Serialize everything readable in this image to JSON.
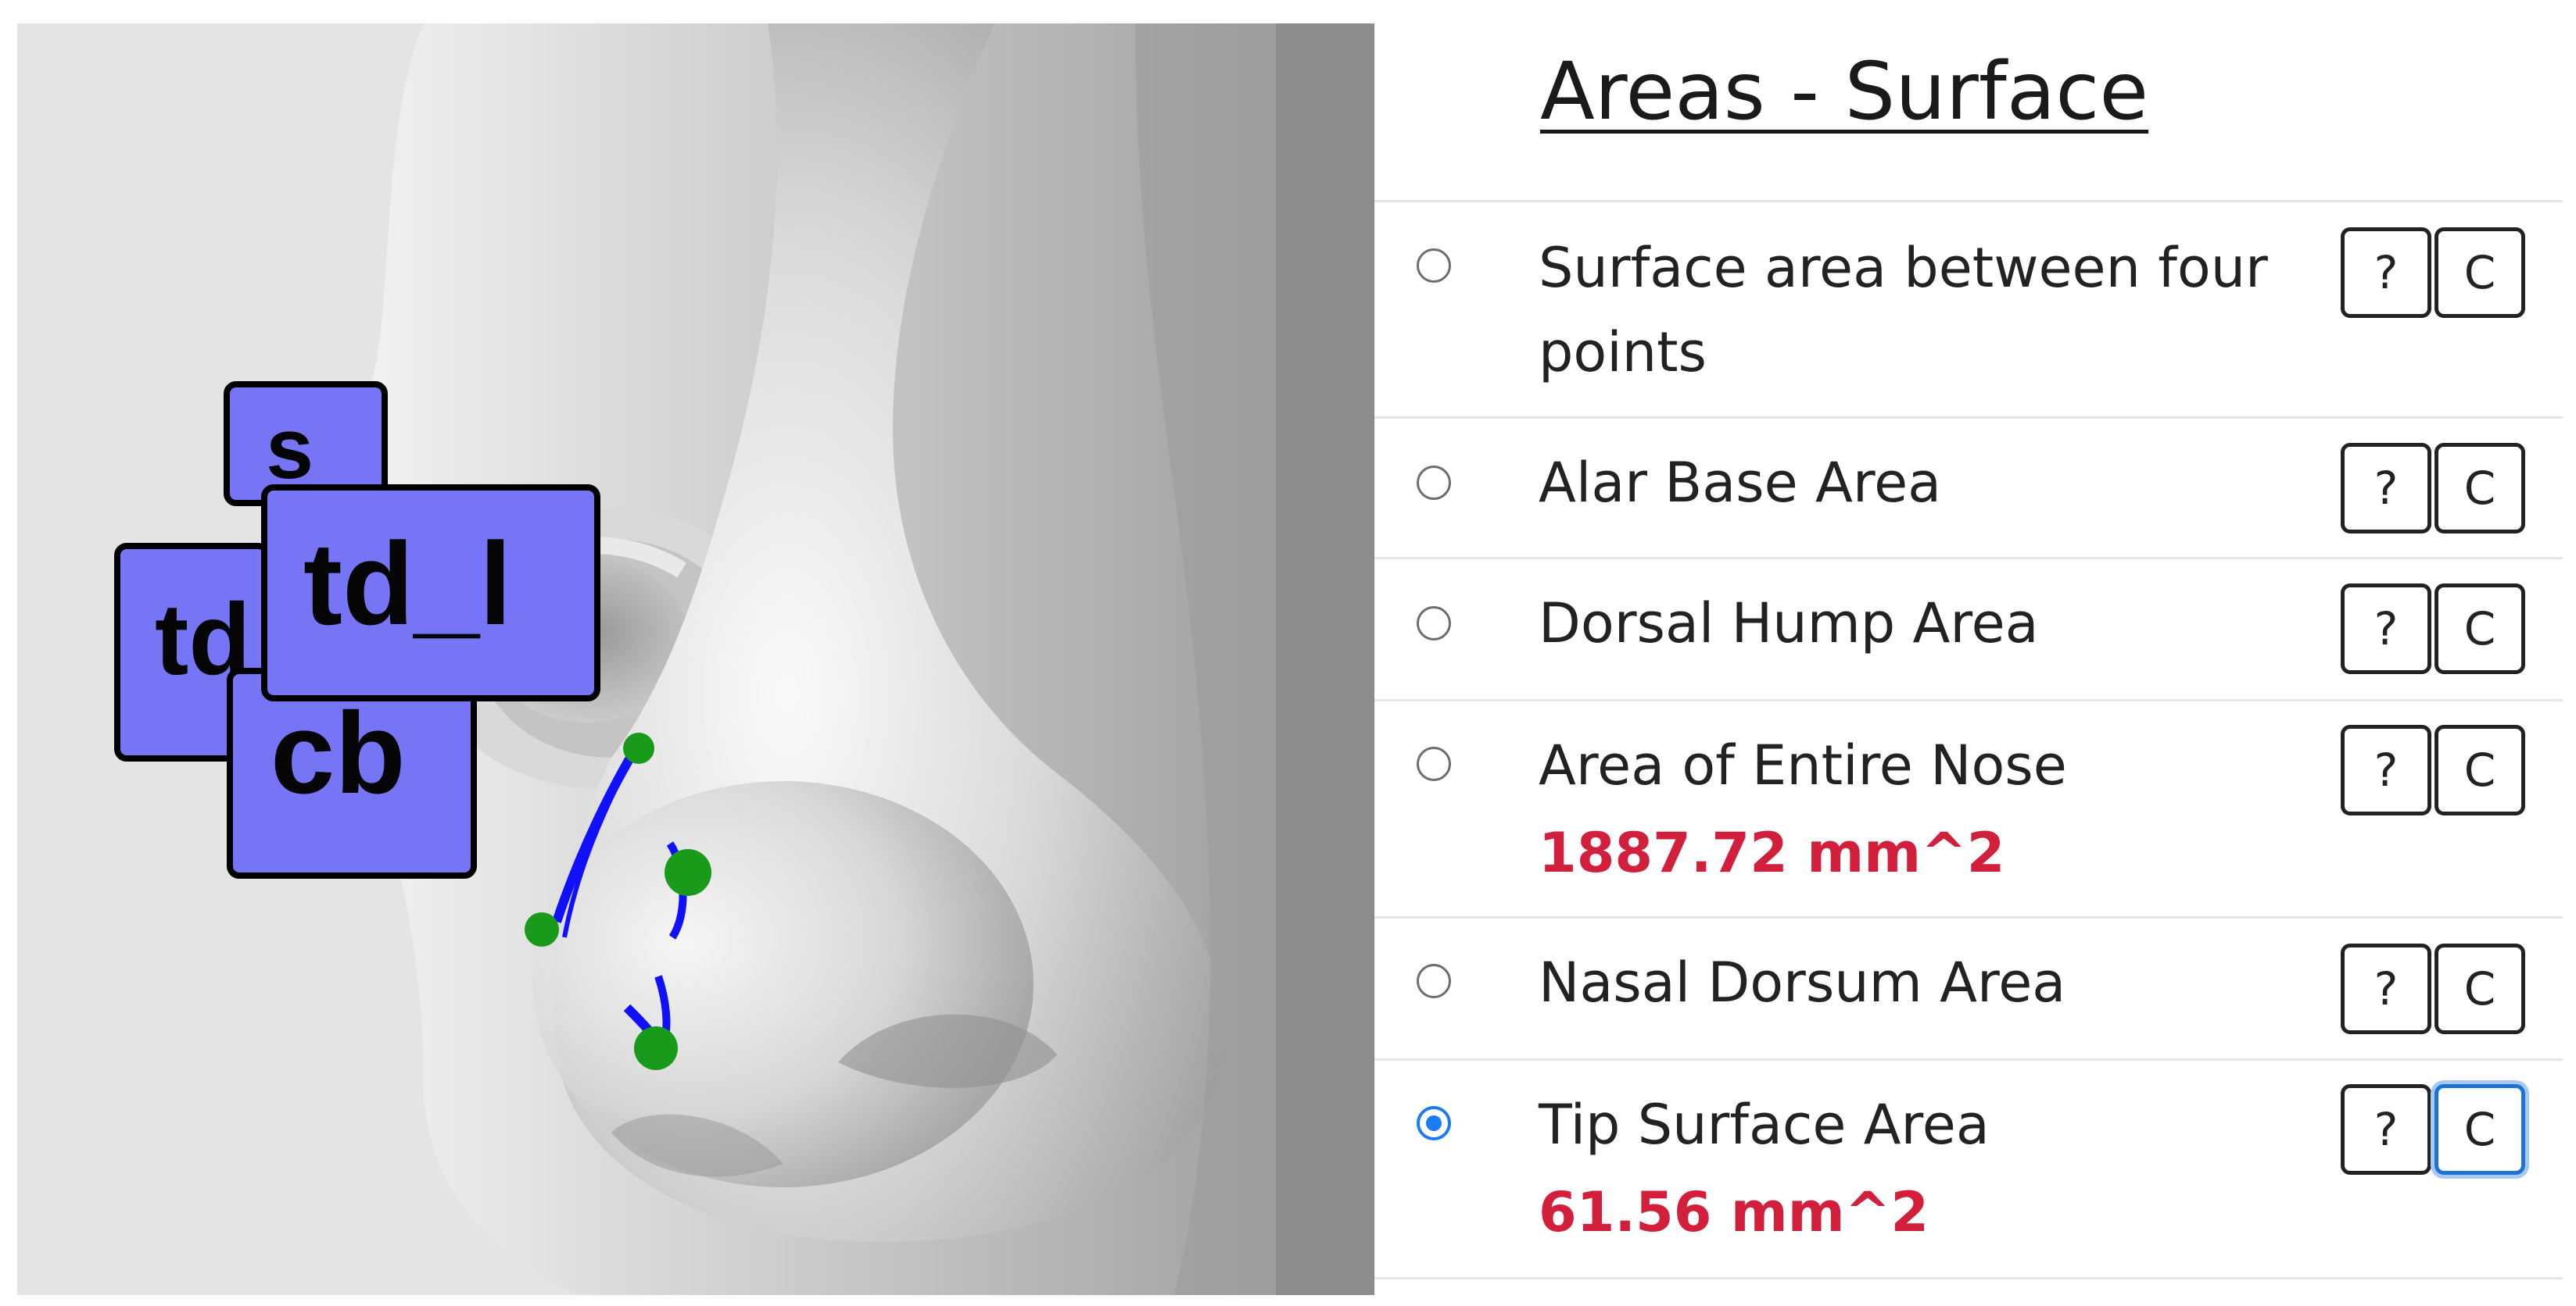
{
  "viewer": {
    "landmarks": [
      {
        "id": "s",
        "label": "s"
      },
      {
        "id": "td-left",
        "label": "td"
      },
      {
        "id": "td-l",
        "label": "td_l"
      },
      {
        "id": "cb",
        "label": "cb"
      }
    ],
    "colors": {
      "label_fill": "#7575f5",
      "point_color": "#1a9a1a",
      "line_color": "#1010ff"
    }
  },
  "panel": {
    "title": "Areas - Surface",
    "buttons": {
      "help_label": "?",
      "calc_label": "C"
    },
    "measurements": [
      {
        "label": "Surface area between four points",
        "value": "",
        "selected": false
      },
      {
        "label": "Alar Base Area",
        "value": "",
        "selected": false
      },
      {
        "label": "Dorsal Hump Area",
        "value": "",
        "selected": false
      },
      {
        "label": "Area of Entire Nose",
        "value": "1887.72 mm^2",
        "selected": false
      },
      {
        "label": "Nasal Dorsum Area",
        "value": "",
        "selected": false
      },
      {
        "label": "Tip Surface Area",
        "value": "61.56 mm^2",
        "selected": true
      }
    ],
    "value_color": "#d21f3c",
    "accent_color": "#1a7cf5"
  }
}
